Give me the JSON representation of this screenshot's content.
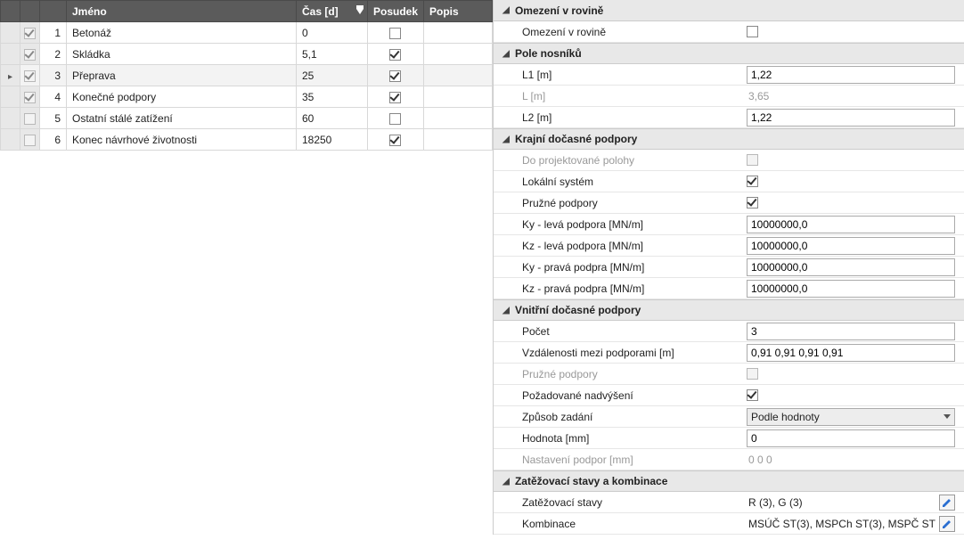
{
  "table": {
    "headers": {
      "name": "Jméno",
      "time": "Čas [d]",
      "assess": "Posudek",
      "desc": "Popis"
    },
    "rows": [
      {
        "n": "1",
        "name": "Betonáž",
        "time": "0",
        "assess": false,
        "sel": false,
        "chk": true
      },
      {
        "n": "2",
        "name": "Skládka",
        "time": "5,1",
        "assess": true,
        "sel": false,
        "chk": true
      },
      {
        "n": "3",
        "name": "Přeprava",
        "time": "25",
        "assess": true,
        "sel": true,
        "chk": true
      },
      {
        "n": "4",
        "name": "Konečné podpory",
        "time": "35",
        "assess": true,
        "sel": false,
        "chk": true
      },
      {
        "n": "5",
        "name": "Ostatní stálé zatížení",
        "time": "60",
        "assess": false,
        "sel": false,
        "chk": false
      },
      {
        "n": "6",
        "name": "Konec návrhové životnosti",
        "time": "18250",
        "assess": true,
        "sel": false,
        "chk": false
      }
    ]
  },
  "panel": {
    "sect_plane": {
      "title": "Omezení v rovině",
      "item": "Omezení v rovině",
      "checked": false
    },
    "sect_field": {
      "title": "Pole nosníků",
      "l1_lbl": "L1 [m]",
      "l1": "1,22",
      "l_lbl": "L [m]",
      "l": "3,65",
      "l2_lbl": "L2 [m]",
      "l2": "1,22"
    },
    "sect_outer": {
      "title": "Krajní dočasné podpory",
      "proj_lbl": "Do projektované polohy",
      "proj": false,
      "local_lbl": "Lokální systém",
      "local": true,
      "spring_lbl": "Pružné podpory",
      "spring": true,
      "kyl_lbl": "Ky - levá podpora [MN/m]",
      "kyl": "10000000,0",
      "kzl_lbl": "Kz - levá podpora [MN/m]",
      "kzl": "10000000,0",
      "kyr_lbl": "Ky - pravá podpra [MN/m]",
      "kyr": "10000000,0",
      "kzr_lbl": "Kz - pravá podpra [MN/m]",
      "kzr": "10000000,0"
    },
    "sect_inner": {
      "title": "Vnitřní dočasné podpory",
      "count_lbl": "Počet",
      "count": "3",
      "dist_lbl": "Vzdálenosti mezi podporami [m]",
      "dist": "0,91 0,91 0,91 0,91",
      "spring_lbl": "Pružné podpory",
      "spring": false,
      "rise_lbl": "Požadované nadvýšení",
      "rise": true,
      "mode_lbl": "Způsob zadání",
      "mode": "Podle hodnoty",
      "val_lbl": "Hodnota [mm]",
      "val": "0",
      "set_lbl": "Nastavení podpor [mm]",
      "set": "0  0  0"
    },
    "sect_load": {
      "title": "Zatěžovací stavy a kombinace",
      "cases_lbl": "Zatěžovací stavy",
      "cases": "R (3), G (3)",
      "comb_lbl": "Kombinace",
      "comb": "MSÚČ ST(3), MSPCh ST(3), MSPČ ST"
    }
  }
}
